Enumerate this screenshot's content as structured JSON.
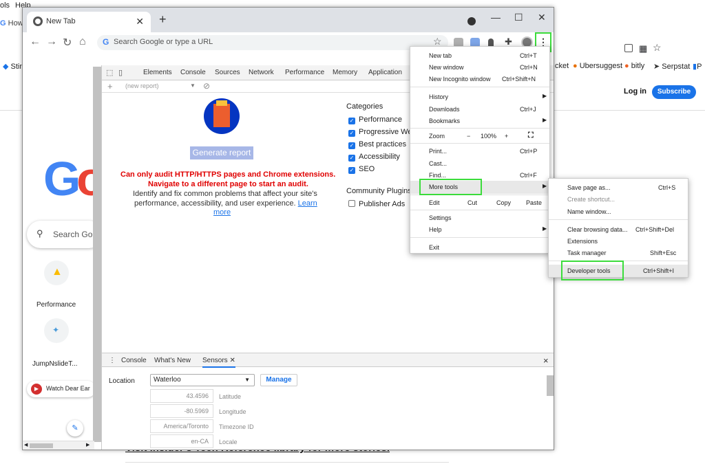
{
  "background": {
    "menu": [
      "ols",
      "Help"
    ],
    "tab_partial": "How",
    "bookmarks": [
      {
        "label": "Stin"
      },
      {
        "label": "cket"
      },
      {
        "label": "Ubersuggest"
      },
      {
        "label": "bitly"
      },
      {
        "label": "Serpstat"
      },
      {
        "label": "P"
      }
    ],
    "login": "Log in",
    "subscribe": "Subscribe",
    "caption": "Visit Insider's Tech Reference library for more stories."
  },
  "window": {
    "tab_title": "New Tab",
    "new_tab": "+",
    "omnibox_placeholder": "Search Google or type a URL"
  },
  "newtab_page": {
    "search_placeholder": "Search Go",
    "shortcuts": [
      {
        "label": "Performance",
        "icon": "google-ads-icon"
      },
      {
        "label": "JumpNslideT...",
        "icon": "slide-icon"
      }
    ],
    "watch": "Watch Dear Ear"
  },
  "devtools": {
    "tabs": [
      "Elements",
      "Console",
      "Sources",
      "Network",
      "Performance",
      "Memory",
      "Application"
    ],
    "report_select": "(new report)",
    "generate": "Generate report",
    "error_line1": "Can only audit HTTP/HTTPS pages and Chrome extensions.",
    "error_line2": "Navigate to a different page to start an audit.",
    "desc_line1": "Identify and fix common problems that affect your site's",
    "desc_line2": "performance, accessibility, and user experience.",
    "learn": "Learn",
    "more": "more",
    "categories_title": "Categories",
    "categories": [
      {
        "label": "Performance",
        "checked": true
      },
      {
        "label": "Progressive Web",
        "checked": true
      },
      {
        "label": "Best practices",
        "checked": true
      },
      {
        "label": "Accessibility",
        "checked": true
      },
      {
        "label": "SEO",
        "checked": true
      }
    ],
    "plugins_title": "Community Plugins",
    "plugins": [
      {
        "label": "Publisher Ads",
        "checked": false
      }
    ],
    "drawer": {
      "tabs": [
        "Console",
        "What's New",
        "Sensors"
      ],
      "close_x": "×",
      "location_label": "Location",
      "location_value": "Waterloo",
      "manage": "Manage",
      "fields": [
        {
          "value": "43.4596",
          "label": "Latitude"
        },
        {
          "value": "-80.5969",
          "label": "Longitude"
        },
        {
          "value": "America/Toronto",
          "label": "Timezone ID"
        },
        {
          "value": "en-CA",
          "label": "Locale"
        }
      ]
    }
  },
  "chrome_menu": {
    "items": [
      {
        "label": "New tab",
        "key": "Ctrl+T"
      },
      {
        "label": "New window",
        "key": "Ctrl+N"
      },
      {
        "label": "New Incognito window",
        "key": "Ctrl+Shift+N"
      },
      {
        "label": "History",
        "key": ""
      },
      {
        "label": "Downloads",
        "key": "Ctrl+J"
      },
      {
        "label": "Bookmarks",
        "key": ""
      },
      {
        "label": "Print...",
        "key": "Ctrl+P"
      },
      {
        "label": "Cast...",
        "key": ""
      },
      {
        "label": "Find...",
        "key": "Ctrl+F"
      },
      {
        "label": "More tools",
        "key": ""
      },
      {
        "label": "Settings",
        "key": ""
      },
      {
        "label": "Help",
        "key": ""
      },
      {
        "label": "Exit",
        "key": ""
      }
    ],
    "zoom_label": "Zoom",
    "zoom_minus": "−",
    "zoom_value": "100%",
    "zoom_plus": "+",
    "edit_label": "Edit",
    "cut": "Cut",
    "copy": "Copy",
    "paste": "Paste"
  },
  "more_tools_menu": {
    "items": [
      {
        "label": "Save page as...",
        "key": "Ctrl+S"
      },
      {
        "label": "Create shortcut...",
        "key": ""
      },
      {
        "label": "Name window...",
        "key": ""
      },
      {
        "label": "Clear browsing data...",
        "key": "Ctrl+Shift+Del"
      },
      {
        "label": "Extensions",
        "key": ""
      },
      {
        "label": "Task manager",
        "key": "Shift+Esc"
      },
      {
        "label": "Developer tools",
        "key": "Ctrl+Shift+I"
      }
    ]
  },
  "colors": {
    "highlight_box": "#3bdc3b",
    "accent": "#1a73e8",
    "error": "#e00000"
  }
}
